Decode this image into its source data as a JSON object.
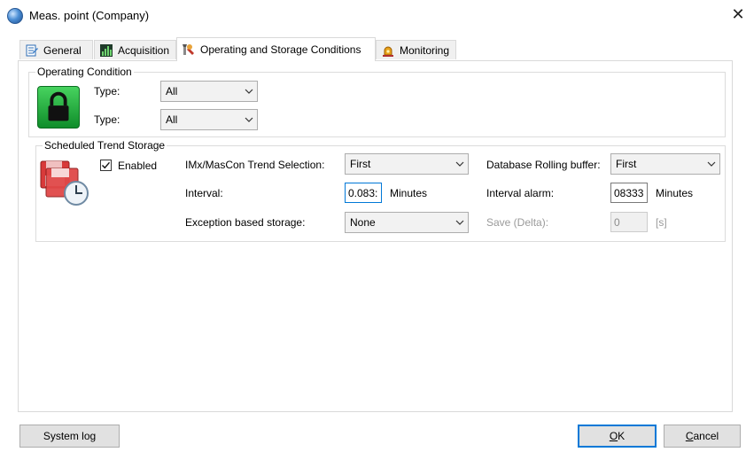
{
  "window": {
    "title": "Meas. point (Company)",
    "close_glyph": "✕",
    "icon": "globe-icon"
  },
  "tabs": [
    {
      "label": "General",
      "icon": "edit-page-icon",
      "active": false
    },
    {
      "label": "Acquisition",
      "icon": "chart-icon",
      "active": false
    },
    {
      "label": "Operating and Storage Conditions",
      "icon": "tools-icon",
      "active": true
    },
    {
      "label": "Monitoring",
      "icon": "alarm-light-icon",
      "active": false
    }
  ],
  "operating_condition": {
    "legend": "Operating Condition",
    "icon": "padlock-icon",
    "rows": [
      {
        "label": "Type:",
        "value": "All"
      },
      {
        "label": "Type:",
        "value": "All"
      }
    ]
  },
  "trend_storage": {
    "legend": "Scheduled Trend Storage",
    "icon": "floppy-clock-icon",
    "enabled_label": "Enabled",
    "enabled_checked": true,
    "selection_label": "IMx/MasCon Trend Selection:",
    "selection_value": "First",
    "interval_label": "Interval:",
    "interval_value": "0.083:",
    "interval_unit": "Minutes",
    "exception_label": "Exception based storage:",
    "exception_value": "None",
    "rolling_label": "Database Rolling buffer:",
    "rolling_value": "First",
    "alarm_label": "Interval alarm:",
    "alarm_value": "08333",
    "alarm_unit": "Minutes",
    "save_label": "Save (Delta):",
    "save_value": "0",
    "save_unit": "[s]"
  },
  "buttons": {
    "system_log": "System log",
    "ok_mnemonic": "O",
    "ok_rest": "K",
    "cancel_mnemonic": "C",
    "cancel_rest": "ancel"
  },
  "colors": {
    "accent": "#0078d7",
    "lock_green": "#1fae3b",
    "floppy_red": "#d83a3a"
  }
}
